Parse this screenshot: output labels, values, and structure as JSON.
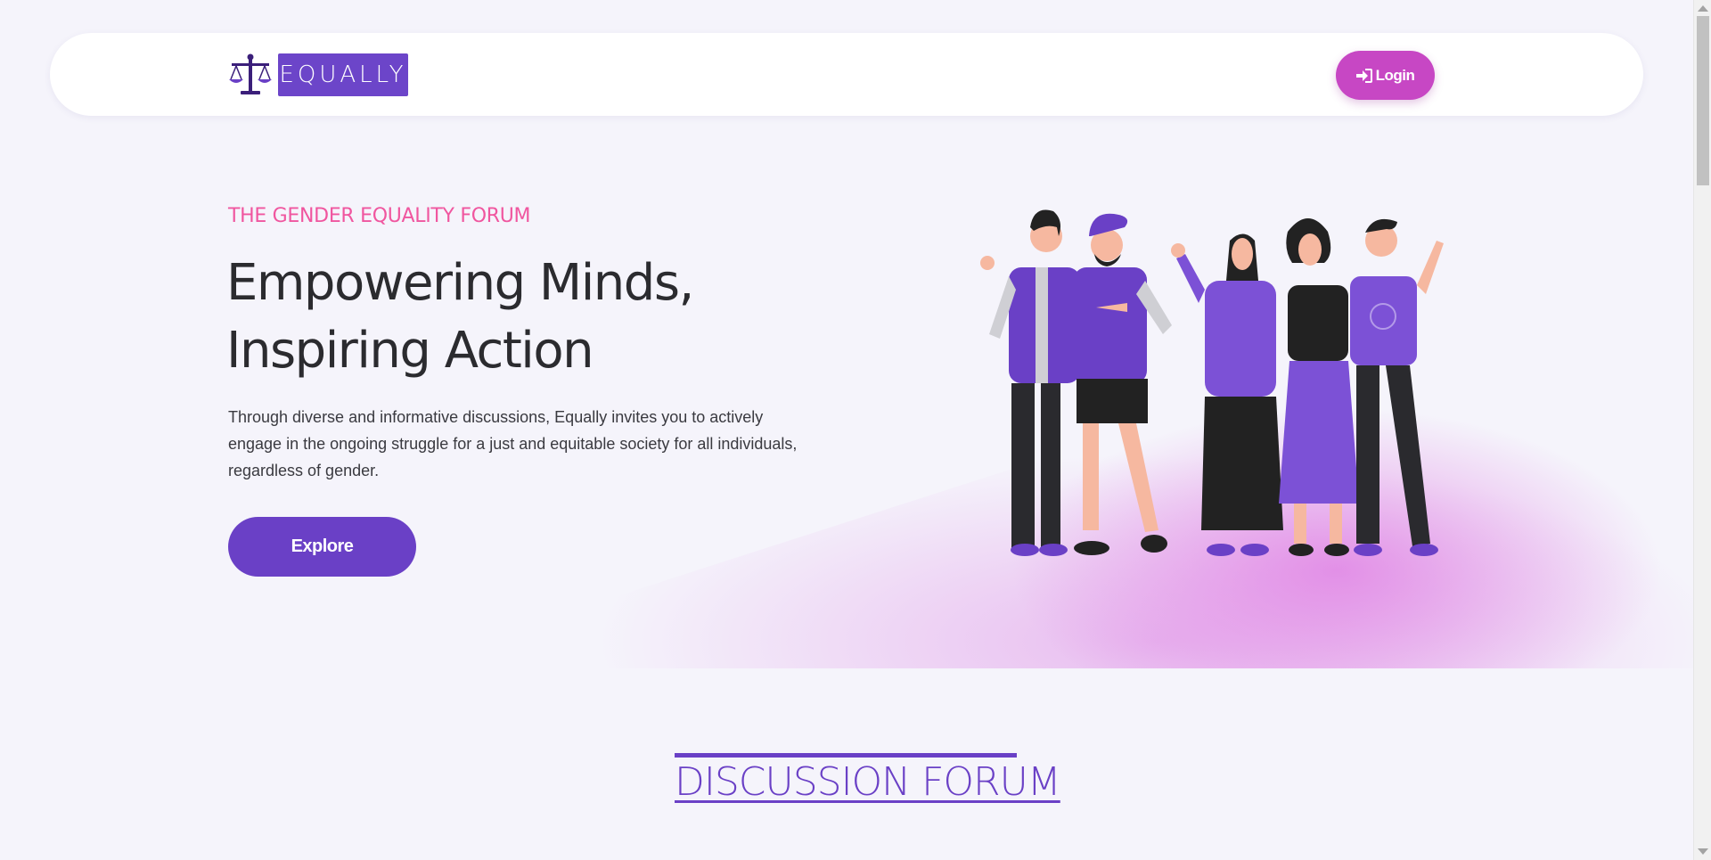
{
  "colors": {
    "background": "#f5f4fb",
    "brand_purple": "#6a40c6",
    "login_pink": "#c747c4",
    "eyebrow_pink": "#f0569f",
    "gradient_pink": "#de78e2"
  },
  "navbar": {
    "brand_text": "EQUALLY",
    "brand_icon": "scales-of-justice-icon",
    "login_label": "Login",
    "login_icon": "sign-in-icon"
  },
  "hero": {
    "eyebrow": "THE GENDER EQUALITY FORUM",
    "headline_line1": "Empowering Minds,",
    "headline_line2": "Inspiring Action",
    "intro": "Through diverse and informative discussions, Equally invites you to actively engage in the ongoing struggle for a just and equitable society for all individuals, regardless of gender.",
    "explore_label": "Explore",
    "illustration": "diverse-group-of-people-illustration"
  },
  "discussion": {
    "title": "DISCUSSION FORUM"
  }
}
